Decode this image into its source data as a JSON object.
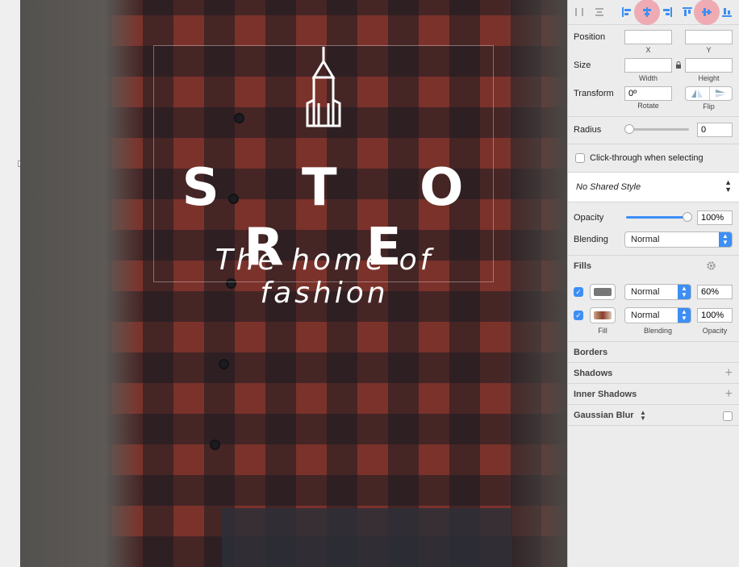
{
  "canvas": {
    "title": "S T O R E",
    "tagline": "The home of fashion",
    "colors": {
      "shirt_red": "#a8382c",
      "text": "#ffffff"
    }
  },
  "inspector": {
    "toolbar": {
      "icons": [
        "distribute-horizontal-icon",
        "distribute-vertical-icon",
        "align-left-icon",
        "align-center-horizontal-icon",
        "align-right-icon",
        "align-top-icon",
        "align-middle-vertical-icon",
        "align-bottom-icon"
      ],
      "highlight_color": "#f096a0"
    },
    "position": {
      "label": "Position",
      "x_value": "",
      "y_value": "",
      "x_label": "X",
      "y_label": "Y"
    },
    "size": {
      "label": "Size",
      "width_value": "",
      "height_value": "",
      "width_label": "Width",
      "height_label": "Height"
    },
    "transform": {
      "label": "Transform",
      "rotate_value": "0º",
      "rotate_label": "Rotate",
      "flip_label": "Flip"
    },
    "radius": {
      "label": "Radius",
      "value": "0"
    },
    "click_through": {
      "label": "Click-through when selecting",
      "checked": false
    },
    "shared_style": {
      "value": "No Shared Style"
    },
    "opacity": {
      "label": "Opacity",
      "value": "100%",
      "level": 1.0
    },
    "blending": {
      "label": "Blending",
      "value": "Normal"
    },
    "fills": {
      "title": "Fills",
      "rows": [
        {
          "checked": true,
          "swatch": "#777777",
          "blend": "Normal",
          "opacity": "60%"
        },
        {
          "checked": true,
          "swatch": "image",
          "blend": "Normal",
          "opacity": "100%"
        }
      ],
      "col_fill": "Fill",
      "col_blending": "Blending",
      "col_opacity": "Opacity"
    },
    "borders": {
      "title": "Borders"
    },
    "shadows": {
      "title": "Shadows"
    },
    "inner_shadows": {
      "title": "Inner Shadows"
    },
    "gaussian_blur": {
      "title": "Gaussian Blur"
    },
    "accent": "#3d8ef5"
  }
}
